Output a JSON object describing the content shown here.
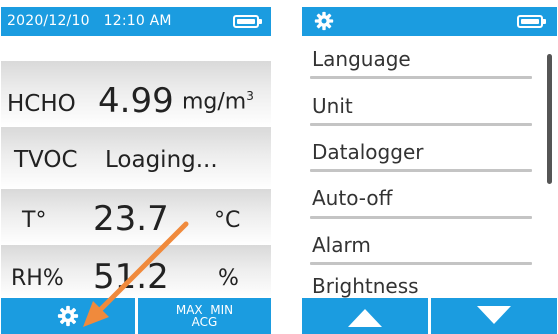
{
  "left_screen": {
    "status": {
      "datetime": "2020/12/10   12:10 AM",
      "battery": "battery-full-icon"
    },
    "hcho": {
      "label": "HCHO",
      "value": "4.99",
      "unit": "mg/m",
      "unit_sup": "3"
    },
    "tvoc": {
      "label": "TVOC",
      "value": "Loaging..."
    },
    "temperature": {
      "label": "T°",
      "value": "23.7",
      "unit": "°C"
    },
    "humidity": {
      "label": "RH%",
      "value": "51.2",
      "unit": "%"
    },
    "bottom_bar": {
      "settings_icon": "gear-icon",
      "stats_line1": "MAX  MIN",
      "stats_line2": "ACG"
    }
  },
  "right_screen": {
    "status": {
      "settings_icon": "gear-icon",
      "battery": "battery-full-icon"
    },
    "menu_items": [
      "Language",
      "Unit",
      "Datalogger",
      "Auto-off",
      "Alarm",
      "Brightness"
    ],
    "bottom_bar": {
      "up_icon": "triangle-up-icon",
      "down_icon": "triangle-down-icon"
    }
  },
  "colors": {
    "accent": "#1b9ce0",
    "annotation_arrow": "#f08a3c",
    "text": "#222222"
  }
}
